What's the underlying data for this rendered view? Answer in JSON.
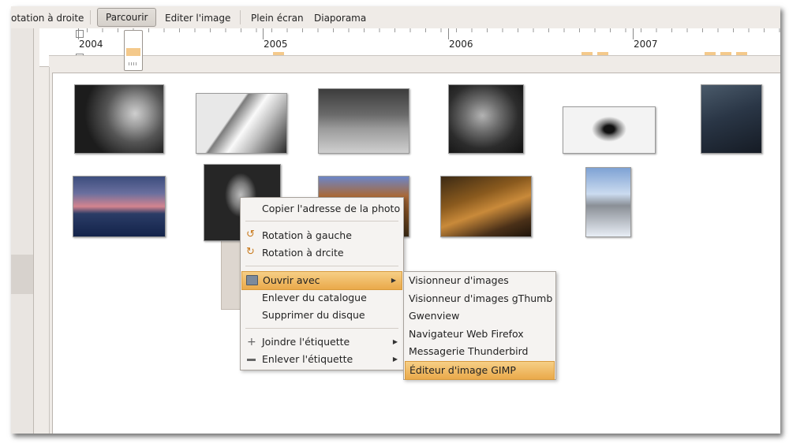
{
  "toolbar": {
    "rotate_right": "otation à droite",
    "browse": "Parcourir",
    "edit_image": "Editer l'image",
    "fullscreen": "Plein écran",
    "slideshow": "Diaporama"
  },
  "timeline": {
    "years": [
      "2004",
      "2005",
      "2006",
      "2007"
    ]
  },
  "context_menu": {
    "copy_address": "Copier l'adresse de la photo",
    "rotate_left": "Rotation à gauche",
    "rotate_right": "Rotation à drcite",
    "open_with": "Ouvrir avec",
    "remove_catalog": "Enlever du catalogue",
    "delete_disk": "Supprimer du disque",
    "attach_tag": "Joindre l'étiquette",
    "remove_tag": "Enlever l'étiquette"
  },
  "submenu": {
    "items": [
      "Visionneur d'images",
      "Visionneur d'images gThumb",
      "Gwenview",
      "Navigateur Web Firefox",
      "Messagerie Thunderbird",
      "Éditeur d'image GIMP"
    ]
  },
  "colors": {
    "highlight": "#eaa94a",
    "timeline_bar": "#f4c98b"
  }
}
